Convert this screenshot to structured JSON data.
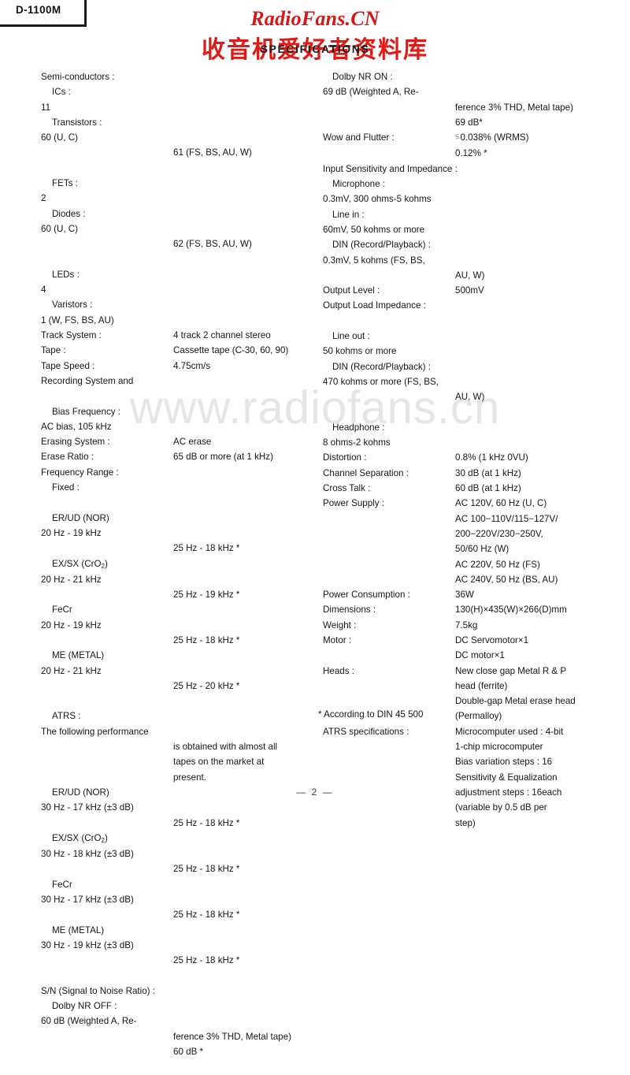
{
  "model_tag": {
    "label": "D-1100M"
  },
  "watermarks": {
    "top_en": "RadioFans.CN",
    "top_cn": "收音机爱好者资料库",
    "middle": "www.radiofans.cn",
    "red_hex": "#d71616",
    "grey_hex": "#e6e6e6"
  },
  "section_title": "SPECIFICATIONS",
  "footnote": "* According to DIN 45 500",
  "page_number": "— 2 —",
  "left_column": [
    {
      "label": "Semi-conductors :",
      "indent": 0,
      "values": []
    },
    {
      "label": "ICs :",
      "indent": 1,
      "values": [
        "11"
      ]
    },
    {
      "label": "Transistors :",
      "indent": 1,
      "values": [
        "60 (U, C)",
        "61 (FS, BS, AU, W)"
      ]
    },
    {
      "label": "FETs :",
      "indent": 1,
      "values": [
        "2"
      ]
    },
    {
      "label": "Diodes :",
      "indent": 1,
      "values": [
        "60 (U, C)",
        "62 (FS, BS, AU, W)"
      ]
    },
    {
      "label": "LEDs :",
      "indent": 1,
      "values": [
        "4"
      ]
    },
    {
      "label": "Varistors :",
      "indent": 1,
      "values": [
        "1 (W, FS, BS, AU)"
      ]
    },
    {
      "label": "Track System :",
      "indent": 0,
      "values": [
        "4 track 2 channel stereo"
      ]
    },
    {
      "label": "Tape :",
      "indent": 0,
      "values": [
        "Cassette tape (C-30, 60, 90)"
      ]
    },
    {
      "label": "Tape Speed :",
      "indent": 0,
      "values": [
        "4.75cm/s"
      ]
    },
    {
      "label": "Recording System and",
      "indent": 0,
      "values": []
    },
    {
      "label": "Bias Frequency :",
      "indent": 1,
      "values": [
        "AC bias, 105 kHz"
      ]
    },
    {
      "label": "Erasing System :",
      "indent": 0,
      "values": [
        "AC erase"
      ]
    },
    {
      "label": "Erase Ratio :",
      "indent": 0,
      "values": [
        "65 dB or more (at 1 kHz)"
      ]
    },
    {
      "label": "Frequency Range :",
      "indent": 0,
      "values": []
    },
    {
      "label": "Fixed :",
      "indent": 1,
      "values": []
    },
    {
      "label": "ER/UD (NOR)",
      "indent": 1,
      "values": [
        "20 Hz - 19 kHz",
        "25 Hz - 18 kHz *"
      ]
    },
    {
      "label": "EX/SX (CrO2)",
      "indent": 1,
      "sub": true,
      "values": [
        "20 Hz - 21 kHz",
        "25 Hz - 19 kHz *"
      ]
    },
    {
      "label": "FeCr",
      "indent": 1,
      "values": [
        "20 Hz - 19 kHz",
        "25 Hz - 18 kHz *"
      ]
    },
    {
      "label": "ME (METAL)",
      "indent": 1,
      "values": [
        "20 Hz - 21 kHz",
        "25 Hz - 20 kHz *"
      ]
    },
    {
      "label": "ATRS :",
      "indent": 1,
      "values": [
        "The following performance",
        "is obtained with almost all",
        "tapes on the market at",
        "present."
      ]
    },
    {
      "label": "ER/UD (NOR)",
      "indent": 1,
      "values": [
        "30 Hz - 17 kHz (±3 dB)",
        "25 Hz - 18 kHz *"
      ]
    },
    {
      "label": "EX/SX (CrO2)",
      "indent": 1,
      "sub": true,
      "values": [
        "30 Hz - 18 kHz (±3 dB)",
        "25 Hz - 18 kHz *"
      ]
    },
    {
      "label": "FeCr",
      "indent": 1,
      "values": [
        "30 Hz - 17 kHz (±3 dB)",
        "25 Hz - 18 kHz *"
      ]
    },
    {
      "label": "ME (METAL)",
      "indent": 1,
      "values": [
        "30 Hz - 19 kHz (±3 dB)",
        "25 Hz - 18 kHz *"
      ]
    },
    {
      "label": "S/N (Signal to Noise Ratio) :",
      "indent": 0,
      "values": []
    },
    {
      "label": "Dolby NR OFF :",
      "indent": 1,
      "values": [
        "60 dB (Weighted A, Re-",
        "ference 3% THD, Metal tape)",
        "60 dB *"
      ]
    }
  ],
  "right_column": [
    {
      "label": "Dolby NR ON :",
      "indent": 1,
      "values": [
        "69 dB (Weighted A, Re-",
        "ference 3% THD, Metal tape)",
        "69 dB*"
      ]
    },
    {
      "label": "Wow and Flutter :",
      "indent": 0,
      "le": true,
      "values": [
        "0.038% (WRMS)",
        "0.12% *"
      ]
    },
    {
      "label": "Input Sensitivity and Impedance :",
      "indent": 0,
      "values": []
    },
    {
      "label": "Microphone :",
      "indent": 1,
      "values": [
        "0.3mV, 300 ohms-5 kohms"
      ]
    },
    {
      "label": "Line in :",
      "indent": 1,
      "values": [
        "60mV, 50 kohms or more"
      ]
    },
    {
      "label": "DIN (Record/Playback) :",
      "indent": 1,
      "values": [
        "0.3mV, 5 kohms (FS, BS,",
        "AU, W)"
      ]
    },
    {
      "label": "Output Level :",
      "indent": 0,
      "values": [
        "500mV"
      ]
    },
    {
      "label": "Output Load Impedance :",
      "indent": 0,
      "values": []
    },
    {
      "label": "Line out :",
      "indent": 1,
      "values": [
        "50 kohms or more"
      ]
    },
    {
      "label": "DIN (Record/Playback) :",
      "indent": 1,
      "values": [
        "470 kohms or more (FS, BS,",
        "AU, W)"
      ]
    },
    {
      "label": "Headphone :",
      "indent": 1,
      "values": [
        "8 ohms-2 kohms"
      ]
    },
    {
      "label": "Distortion :",
      "indent": 0,
      "values": [
        "0.8% (1 kHz 0VU)"
      ]
    },
    {
      "label": "Channel Separation :",
      "indent": 0,
      "values": [
        "30 dB (at 1 kHz)"
      ]
    },
    {
      "label": "Cross Talk :",
      "indent": 0,
      "values": [
        "60 dB (at 1 kHz)"
      ]
    },
    {
      "label": "Power Supply :",
      "indent": 0,
      "values": [
        "AC 120V, 60 Hz (U, C)",
        "AC 100−110V/115−127V/",
        "200−220V/230−250V,",
        "50/60 Hz (W)",
        "AC 220V, 50 Hz (FS)",
        "AC 240V, 50 Hz (BS, AU)"
      ]
    },
    {
      "label": "Power Consumption :",
      "indent": 0,
      "values": [
        "36W"
      ]
    },
    {
      "label": "Dimensions :",
      "indent": 0,
      "values": [
        "130(H)×435(W)×266(D)mm"
      ]
    },
    {
      "label": "Weight :",
      "indent": 0,
      "values": [
        "7.5kg"
      ]
    },
    {
      "label": "Motor :",
      "indent": 0,
      "values": [
        "DC Servomotor×1",
        "DC motor×1"
      ]
    },
    {
      "label": "Heads :",
      "indent": 0,
      "values": [
        "New close gap Metal R & P",
        "head (ferrite)",
        "Double-gap Metal erase head",
        "(Permalloy)"
      ]
    },
    {
      "label": "ATRS specifications :",
      "indent": 0,
      "values": [
        "Microcomputer used : 4-bit",
        "1-chip microcomputer",
        "Bias variation steps : 16",
        "Sensitivity & Equalization",
        "adjustment steps : 16each",
        "(variable by 0.5 dB per",
        "step)"
      ]
    }
  ]
}
